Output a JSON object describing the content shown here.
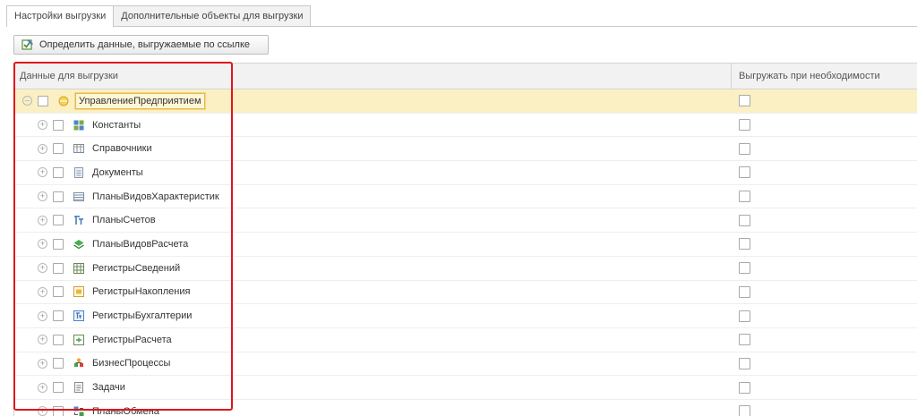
{
  "tabs": [
    {
      "label": "Настройки выгрузки",
      "active": true
    },
    {
      "label": "Дополнительные объекты для выгрузки",
      "active": false
    }
  ],
  "toolbar": {
    "define_button_label": "Определить данные, выгружаемые по ссылке",
    "define_button_icon": "edit-check-icon"
  },
  "table": {
    "col_data": "Данные для выгрузки",
    "col_export_if_needed": "Выгружать при необходимости",
    "root": {
      "label": "УправлениеПредприятием",
      "icon": "config-icon",
      "expanded": true,
      "checked": false,
      "export_if_needed": false
    },
    "items": [
      {
        "label": "Константы",
        "icon": "constants-icon",
        "checked": false,
        "export_if_needed": false
      },
      {
        "label": "Справочники",
        "icon": "catalogs-icon",
        "checked": false,
        "export_if_needed": false
      },
      {
        "label": "Документы",
        "icon": "documents-icon",
        "checked": false,
        "export_if_needed": false
      },
      {
        "label": "ПланыВидовХарактеристик",
        "icon": "characteristic-types-icon",
        "checked": false,
        "export_if_needed": false
      },
      {
        "label": "ПланыСчетов",
        "icon": "chart-of-accounts-icon",
        "checked": false,
        "export_if_needed": false
      },
      {
        "label": "ПланыВидовРасчета",
        "icon": "calculation-types-icon",
        "checked": false,
        "export_if_needed": false
      },
      {
        "label": "РегистрыСведений",
        "icon": "information-registers-icon",
        "checked": false,
        "export_if_needed": false
      },
      {
        "label": "РегистрыНакопления",
        "icon": "accumulation-registers-icon",
        "checked": false,
        "export_if_needed": false
      },
      {
        "label": "РегистрыБухгалтерии",
        "icon": "accounting-registers-icon",
        "checked": false,
        "export_if_needed": false
      },
      {
        "label": "РегистрыРасчета",
        "icon": "calculation-registers-icon",
        "checked": false,
        "export_if_needed": false
      },
      {
        "label": "БизнесПроцессы",
        "icon": "business-processes-icon",
        "checked": false,
        "export_if_needed": false
      },
      {
        "label": "Задачи",
        "icon": "tasks-icon",
        "checked": false,
        "export_if_needed": false
      },
      {
        "label": "ПланыОбмена",
        "icon": "exchange-plans-icon",
        "checked": false,
        "export_if_needed": false
      }
    ]
  },
  "colors": {
    "highlight_frame": "#e0151b",
    "selected_row": "#fbf0c4"
  }
}
